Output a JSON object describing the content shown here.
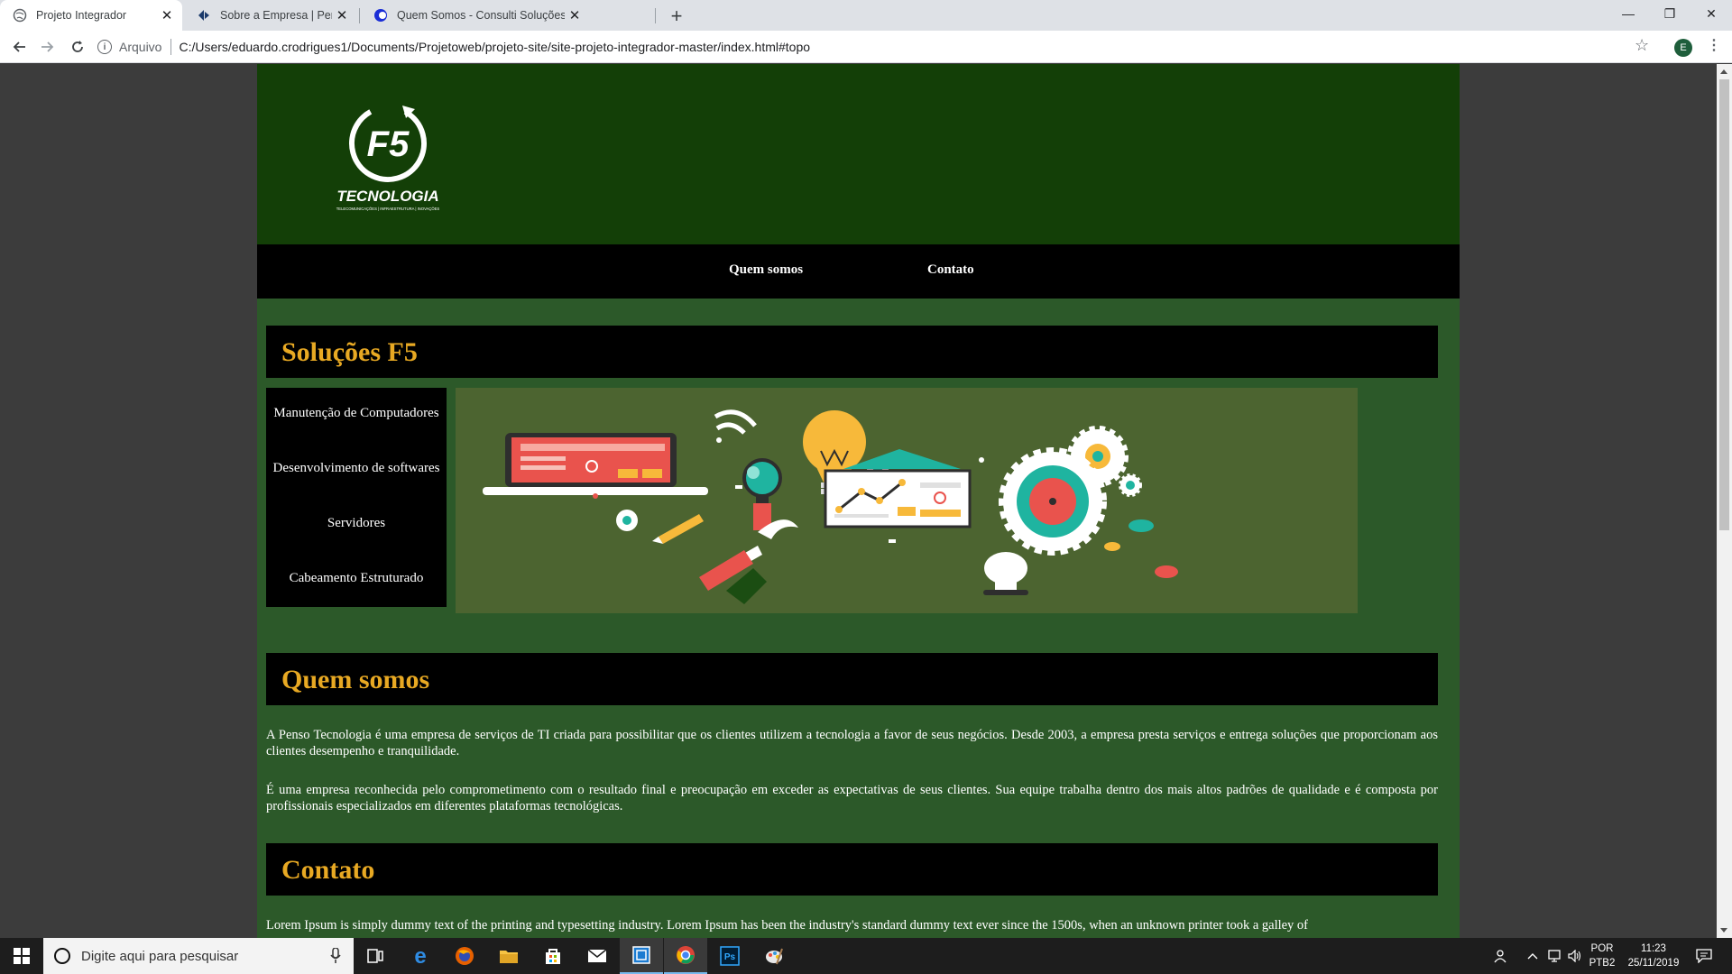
{
  "browser": {
    "tabs": [
      {
        "title": "Projeto Integrador",
        "icon": "globe-icon"
      },
      {
        "title": "Sobre a Empresa | Penso Tecnologia",
        "icon": "penso-logo-icon"
      },
      {
        "title": "Quem Somos - Consulti Soluções",
        "icon": "consulti-logo-icon"
      }
    ],
    "address": {
      "scheme_label": "Arquivo",
      "url": "C:/Users/eduardo.crodrigues1/Documents/Projetoweb/projeto-site/site-projeto-integrador-master/index.html#topo"
    },
    "profile_initial": "E"
  },
  "site": {
    "logo": {
      "main": "F5",
      "word": "TECNOLOGIA",
      "tagline": "TELECOMUNICAÇÕES | INFRAESTRUTURA | INOVAÇÕES"
    },
    "nav": [
      "Quem somos",
      "Contato"
    ],
    "solucoes": {
      "title": "Soluções F5",
      "services": [
        "Manutenção de Computadores",
        "Desenvolvimento de softwares",
        "Servidores",
        "Cabeamento Estruturado"
      ]
    },
    "quem_somos": {
      "title": "Quem somos",
      "p1": "A Penso Tecnologia é uma empresa de serviços de TI criada para possibilitar que os clientes utilizem a tecnologia a favor de seus negócios. Desde 2003, a empresa presta serviços e entrega soluções que proporcionam aos clientes desempenho e tranquilidade.",
      "p2": "É uma empresa reconhecida pelo comprometimento com o resultado final e preocupação em exceder as expectativas de seus clientes. Sua equipe trabalha dentro dos mais altos padrões de qualidade e é composta por profissionais especializados em diferentes plataformas tecnológicas."
    },
    "contato": {
      "title": "Contato",
      "p1": "Lorem Ipsum is simply dummy text of the printing and typesetting industry. Lorem Ipsum has been the industry's standard dummy text ever since the 1500s, when an unknown printer took a galley of"
    }
  },
  "taskbar": {
    "search_placeholder": "Digite aqui para pesquisar",
    "lang_top": "POR",
    "lang_bottom": "PTB2",
    "time": "11:23",
    "date": "25/11/2019"
  },
  "colors": {
    "header_bg": "#133f07",
    "page_bg": "#2c5929",
    "section_title": "#e8a923",
    "banner_bg": "#4c6430"
  }
}
